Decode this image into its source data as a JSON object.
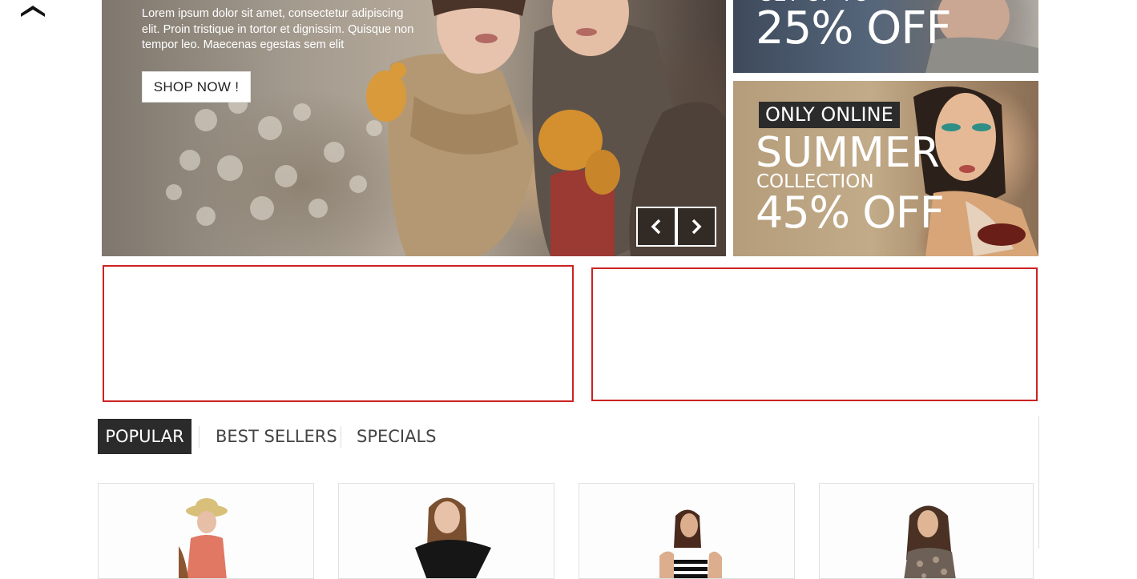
{
  "back_to_top": {
    "icon": "chevron-up-icon"
  },
  "hero": {
    "description": "Lorem ipsum dolor sit amet, consectetur adipiscing elit. Proin tristique in tortor et dignissim. Quisque non tempor leo. Maecenas egestas sem elit",
    "cta_label": "SHOP NOW !",
    "prev_icon": "chevron-left-icon",
    "next_icon": "chevron-right-icon"
  },
  "banners": [
    {
      "pretitle": "GET UP TO",
      "offer": "25% OFF"
    },
    {
      "badge": "ONLY ONLINE",
      "title": "SUMMER",
      "subtitle": "COLLECTION",
      "offer": "45% OFF"
    }
  ],
  "tabs": [
    {
      "label": "POPULAR",
      "active": true
    },
    {
      "label": "BEST SELLERS",
      "active": false
    },
    {
      "label": "SPECIALS",
      "active": false
    }
  ],
  "products": [
    {
      "image": "woman-straw-hat-coral-top"
    },
    {
      "image": "woman-black-ruffle-dress"
    },
    {
      "image": "woman-striped-dress"
    },
    {
      "image": "woman-floral-top"
    }
  ],
  "colors": {
    "accent_dark": "#2b2b2b",
    "ad_border": "#cc2222"
  }
}
